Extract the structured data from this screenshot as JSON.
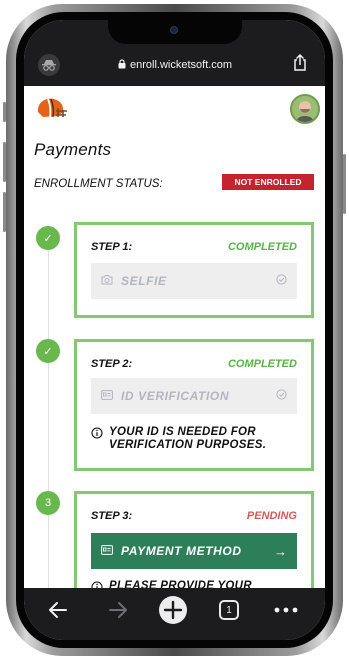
{
  "browser": {
    "url": "enroll.wicketsoft.com",
    "tab_count": "1"
  },
  "page": {
    "title": "Payments",
    "status_label": "ENROLLMENT STATUS:",
    "status_badge": "NOT ENROLLED"
  },
  "steps": [
    {
      "dot": "✓",
      "number": "STEP 1:",
      "state": "COMPLETED",
      "field": "SELFIE"
    },
    {
      "dot": "✓",
      "number": "STEP 2:",
      "state": "COMPLETED",
      "field": "ID VERIFICATION",
      "info": "YOUR ID IS NEEDED FOR VERIFICATION PURPOSES."
    },
    {
      "dot": "3",
      "number": "STEP 3:",
      "state": "PENDING",
      "button": "PAYMENT METHOD",
      "button_arrow": "→",
      "info": "PLEASE PROVIDE YOUR PAYMENT INFORMATION."
    }
  ],
  "colors": {
    "accent_green": "#85c874",
    "completed_text": "#58b247",
    "pending_text": "#d45a5a",
    "badge_red": "#c4242d",
    "button_green": "#2d7f59"
  },
  "icons": {
    "incognito": "incognito-icon",
    "lock": "lock-icon",
    "share": "share-icon",
    "back": "back-arrow-icon",
    "forward": "forward-arrow-icon",
    "new_tab": "plus-icon",
    "tabs": "tabs-icon",
    "more": "more-icon"
  }
}
